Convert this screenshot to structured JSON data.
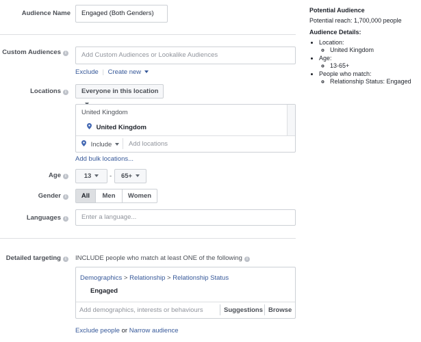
{
  "audience_name": {
    "label": "Audience Name",
    "value": "Engaged (Both Genders)"
  },
  "custom_audiences": {
    "label": "Custom Audiences",
    "placeholder": "Add Custom Audiences or Lookalike Audiences",
    "exclude_link": "Exclude",
    "create_new_link": "Create new"
  },
  "locations": {
    "label": "Locations",
    "dropdown": "Everyone in this location",
    "group_header": "United Kingdom",
    "selected": "United Kingdom",
    "include_label": "Include",
    "add_placeholder": "Add locations",
    "bulk_link": "Add bulk locations..."
  },
  "age": {
    "label": "Age",
    "min": "13",
    "separator": "-",
    "max": "65+"
  },
  "gender": {
    "label": "Gender",
    "options": [
      "All",
      "Men",
      "Women"
    ],
    "selected": "All"
  },
  "languages": {
    "label": "Languages",
    "placeholder": "Enter a language..."
  },
  "detailed_targeting": {
    "label": "Detailed targeting",
    "include_text": "INCLUDE people who match at least ONE of the following",
    "path": [
      "Demographics",
      "Relationship",
      "Relationship Status"
    ],
    "path_separator": ">",
    "selected": "Engaged",
    "placeholder": "Add demographics, interests or behaviours",
    "suggestions": "Suggestions",
    "browse": "Browse",
    "exclude_people": "Exclude people",
    "or_text": "or",
    "narrow_audience": "Narrow audience"
  },
  "right_panel": {
    "potential_title": "Potential Audience",
    "potential_reach": "Potential reach: 1,700,000 people",
    "details_title": "Audience Details:",
    "location_label": "Location:",
    "location_value": "United Kingdom",
    "age_label": "Age:",
    "age_value": "13-65+",
    "match_label": "People who match:",
    "match_value": "Relationship Status: Engaged"
  },
  "colors": {
    "link": "#365899",
    "pin": "#4267b2",
    "border": "#ccd0d5",
    "label": "#4b4f56"
  }
}
